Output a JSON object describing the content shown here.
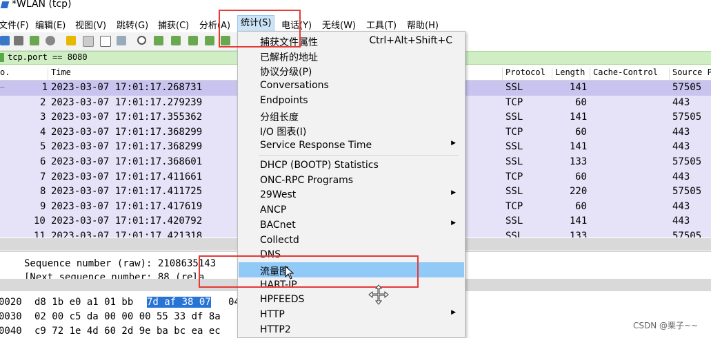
{
  "window": {
    "title": "*WLAN (tcp)"
  },
  "menubar": {
    "items": [
      {
        "id": "file",
        "label": "文件(F)"
      },
      {
        "id": "edit",
        "label": "编辑(E)"
      },
      {
        "id": "view",
        "label": "视图(V)"
      },
      {
        "id": "go",
        "label": "跳转(G)"
      },
      {
        "id": "capture",
        "label": "捕获(C)"
      },
      {
        "id": "analyze",
        "label": "分析(A)"
      },
      {
        "id": "statistics",
        "label": "统计(S)"
      },
      {
        "id": "telephony",
        "label": "电话(Y)"
      },
      {
        "id": "wireless",
        "label": "无线(W)"
      },
      {
        "id": "tools",
        "label": "工具(T)"
      },
      {
        "id": "help",
        "label": "帮助(H)"
      }
    ]
  },
  "filter": {
    "value": "tcp.port == 8080"
  },
  "packet_list": {
    "columns": [
      "o.",
      "Time",
      "Protocol",
      "Length",
      "Cache-Control",
      "Source P"
    ],
    "rows": [
      {
        "no": "1",
        "time": "2023-03-07 17:01:17.268731",
        "protocol": "SSL",
        "length": "141",
        "port": "57505"
      },
      {
        "no": "2",
        "time": "2023-03-07 17:01:17.279239",
        "protocol": "TCP",
        "length": "60",
        "port": "443"
      },
      {
        "no": "3",
        "time": "2023-03-07 17:01:17.355362",
        "protocol": "SSL",
        "length": "141",
        "port": "57505"
      },
      {
        "no": "4",
        "time": "2023-03-07 17:01:17.368299",
        "protocol": "TCP",
        "length": "60",
        "port": "443"
      },
      {
        "no": "5",
        "time": "2023-03-07 17:01:17.368299",
        "protocol": "SSL",
        "length": "141",
        "port": "443"
      },
      {
        "no": "6",
        "time": "2023-03-07 17:01:17.368601",
        "protocol": "SSL",
        "length": "133",
        "port": "57505"
      },
      {
        "no": "7",
        "time": "2023-03-07 17:01:17.411661",
        "protocol": "TCP",
        "length": "60",
        "port": "443"
      },
      {
        "no": "8",
        "time": "2023-03-07 17:01:17.411725",
        "protocol": "SSL",
        "length": "220",
        "port": "57505"
      },
      {
        "no": "9",
        "time": "2023-03-07 17:01:17.417619",
        "protocol": "TCP",
        "length": "60",
        "port": "443"
      },
      {
        "no": "10",
        "time": "2023-03-07 17:01:17.420792",
        "protocol": "SSL",
        "length": "141",
        "port": "443"
      },
      {
        "no": "11",
        "time": "2023-03-07 17:01:17.421318",
        "protocol": "SSL",
        "length": "133",
        "port": "57505"
      }
    ]
  },
  "details": {
    "line1": "Sequence number (raw): 2108635143",
    "line2": "[Next sequence number: 88    (rela"
  },
  "bytes": {
    "rows": [
      {
        "offset": "0020",
        "a": "d8 1b e0 a1 01 bb",
        "hl": "7d af  38 07",
        "b": "04"
      },
      {
        "offset": "0030",
        "a": "02 00 c5 da 00 00 00 55  33 df 8a",
        "hl": "",
        "b": ""
      },
      {
        "offset": "0040",
        "a": "c9 72 1e 4d 60 2d 9e ba  bc ea ec",
        "hl": "",
        "b": ""
      }
    ]
  },
  "stats_menu": {
    "items": [
      {
        "label": "捕获文件属性",
        "shortcut": "Ctrl+Alt+Shift+C",
        "submenu": false
      },
      {
        "label": "已解析的地址",
        "shortcut": "",
        "submenu": false
      },
      {
        "label": "协议分级(P)",
        "shortcut": "",
        "submenu": false
      },
      {
        "label": "Conversations",
        "shortcut": "",
        "submenu": false
      },
      {
        "label": "Endpoints",
        "shortcut": "",
        "submenu": false
      },
      {
        "label": "分组长度",
        "shortcut": "",
        "submenu": false
      },
      {
        "label": "I/O 图表(I)",
        "shortcut": "",
        "submenu": false
      },
      {
        "label": "Service Response Time",
        "shortcut": "",
        "submenu": true
      },
      {
        "label": "DHCP (BOOTP) Statistics",
        "shortcut": "",
        "submenu": false
      },
      {
        "label": "ONC-RPC Programs",
        "shortcut": "",
        "submenu": false
      },
      {
        "label": "29West",
        "shortcut": "",
        "submenu": true
      },
      {
        "label": "ANCP",
        "shortcut": "",
        "submenu": false
      },
      {
        "label": "BACnet",
        "shortcut": "",
        "submenu": true
      },
      {
        "label": "Collectd",
        "shortcut": "",
        "submenu": false
      },
      {
        "label": "DNS",
        "shortcut": "",
        "submenu": false
      },
      {
        "label": "流量图",
        "shortcut": "",
        "submenu": false
      },
      {
        "label": "HART-IP",
        "shortcut": "",
        "submenu": false
      },
      {
        "label": "HPFEEDS",
        "shortcut": "",
        "submenu": false
      },
      {
        "label": "HTTP",
        "shortcut": "",
        "submenu": true
      },
      {
        "label": "HTTP2",
        "shortcut": "",
        "submenu": false
      }
    ],
    "hovered_label": "流量图"
  },
  "watermark": "CSDN @栗子~~",
  "colors": {
    "annotation": "#e53935",
    "menu_hover": "#91c9f7",
    "row_bg": "#e6e2f7",
    "filter_bg": "#cfeec4"
  }
}
